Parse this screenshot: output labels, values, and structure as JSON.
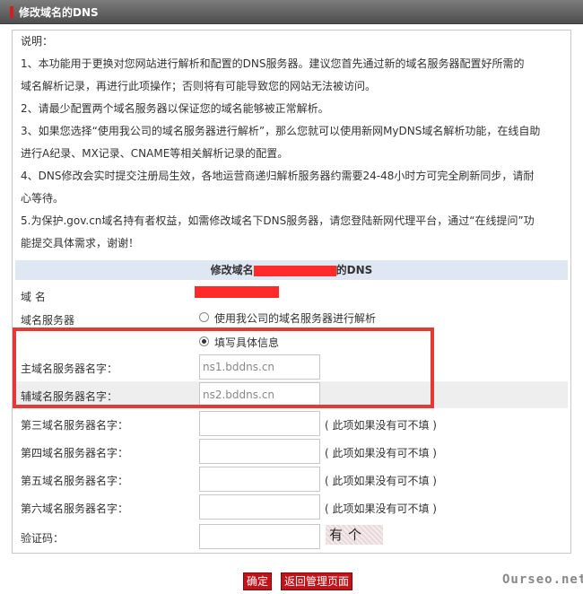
{
  "header": {
    "title": "修改域名的DNS"
  },
  "notes": {
    "heading": "说明：",
    "lines": [
      "1、本功能用于更换对您网站进行解析和配置的DNS服务器。建议您首先通过新的域名服务器配置好所需的",
      "域名解析记录，再进行此项操作；否则将有可能导致您的网站无法被访问。",
      "2、请最少配置两个域名服务器以保证您的域名能够被正常解析。",
      "3、如果您选择“使用我公司的域名服务器进行解析”，那么您就可以使用新网MyDNS域名解析功能，在线自助",
      "进行A纪录、MX记录、CNAME等相关解析记录的配置。",
      "4、DNS修改会实时提交注册局生效，各地运营商递归解析服务器约需要24-48小时方可完全刷新同步，请耐",
      "心等待。",
      "5.为保护.gov.cn域名持有者权益，如需修改域名下DNS服务器，请您登陆新网代理平台，通过“在线提问”功",
      "能提交具体需求，谢谢！"
    ]
  },
  "form": {
    "section_title_prefix": "修改域名",
    "section_title_suffix": "的DNS",
    "domain_label": "域 名",
    "dns_server_label": "域名服务器",
    "option_company": "使用我公司的域名服务器进行解析",
    "option_custom": "填写具体信息",
    "primary_label": "主域名服务器名字：",
    "primary_value": "ns1.bddns.cn",
    "secondary_label": "辅域名服务器名字：",
    "secondary_value": "ns2.bddns.cn",
    "third_label": "第三域名服务器名字：",
    "fourth_label": "第四域名服务器名字：",
    "fifth_label": "第五域名服务器名字：",
    "sixth_label": "第六域名服务器名字：",
    "optional_hint": "( 此项如果没有可不填 )",
    "captcha_label": "验证码：",
    "captcha_text": "有个"
  },
  "buttons": {
    "confirm": "确定",
    "back": "返回管理页面"
  },
  "watermark": "Ourseo.net",
  "colors": {
    "accent": "#c0141b",
    "highlight": "#e53935",
    "header_bg": "#5a5a5a",
    "subheader_bg": "#dfe8f2"
  }
}
